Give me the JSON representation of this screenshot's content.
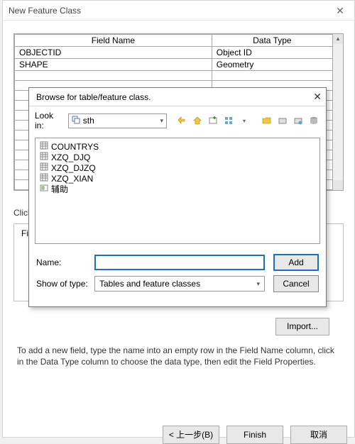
{
  "window": {
    "title": "New Feature Class",
    "close_glyph": "✕"
  },
  "table": {
    "headers": {
      "field_name": "Field Name",
      "data_type": "Data Type"
    },
    "rows": [
      {
        "name": "OBJECTID",
        "type": "Object ID"
      },
      {
        "name": "SHAPE",
        "type": "Geometry"
      },
      {
        "name": "",
        "type": ""
      },
      {
        "name": "",
        "type": ""
      },
      {
        "name": "",
        "type": ""
      },
      {
        "name": "",
        "type": ""
      },
      {
        "name": "",
        "type": ""
      },
      {
        "name": "",
        "type": ""
      },
      {
        "name": "",
        "type": ""
      },
      {
        "name": "",
        "type": ""
      },
      {
        "name": "",
        "type": ""
      },
      {
        "name": "",
        "type": ""
      },
      {
        "name": "",
        "type": ""
      },
      {
        "name": "",
        "type": ""
      }
    ],
    "scroll_up": "▲",
    "scroll_down": ""
  },
  "labels": {
    "click": "Clicl",
    "field_props_prefix": "Fie"
  },
  "import_button": "Import...",
  "help_text": "To add a new field, type the name into an empty row in the Field Name column, click in the Data Type column to choose the data type, then edit the Field Properties.",
  "nav": {
    "back": "< 上一步(B)",
    "finish": "Finish",
    "cancel": "取消"
  },
  "browse": {
    "title": "Browse for table/feature class.",
    "close_glyph": "✕",
    "lookin_label": "Look in:",
    "lookin_value": "sth",
    "toolbar_icons": [
      "up-icon",
      "home-icon",
      "new-icon",
      "list-icon",
      "separator",
      "folder-open-icon",
      "folder-icon",
      "connect-icon",
      "catalog-icon"
    ],
    "files": [
      {
        "icon": "table-icon",
        "name": "COUNTRYS"
      },
      {
        "icon": "table-icon",
        "name": "XZQ_DJQ"
      },
      {
        "icon": "table-icon",
        "name": "XZQ_DJZQ"
      },
      {
        "icon": "table-icon",
        "name": "XZQ_XIAN"
      },
      {
        "icon": "feature-icon",
        "name": "辅助"
      }
    ],
    "name_label": "Name:",
    "name_value": "",
    "type_label": "Show of type:",
    "type_value": "Tables and feature classes",
    "add_button": "Add",
    "cancel_button": "Cancel",
    "chevron": "▾"
  }
}
